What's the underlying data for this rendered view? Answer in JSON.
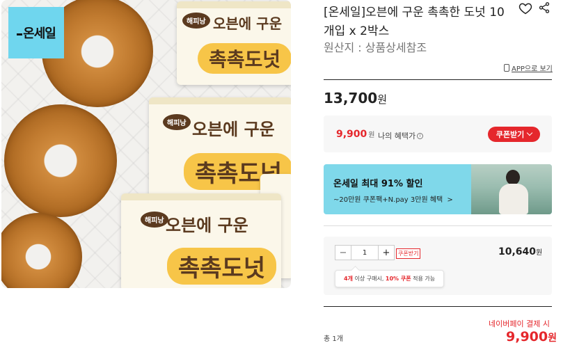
{
  "image": {
    "badge": "온세일",
    "packs": [
      {
        "brand": "해피낭",
        "line1": "오븐에 구운",
        "line2": "촉촉도넛"
      },
      {
        "brand": "해피낭",
        "line1": "오븐에 구운",
        "line2": "촉촉도넛"
      },
      {
        "brand": "해피낭",
        "line1": "오븐에 구운",
        "line2": "촉촉도넛"
      }
    ]
  },
  "product": {
    "title": "[온세일]오븐에 구운 촉촉한 도넛 10개입 x 2박스",
    "origin": "원산지 : 상품상세참조",
    "icons": {
      "wish": "heart-icon",
      "share": "share-icon"
    },
    "app_view": "APP으로 보기",
    "price": "13,700",
    "price_unit": "원"
  },
  "benefit": {
    "price": "9,900",
    "price_unit": "원",
    "label": "나의 혜택가",
    "coupon_button": "쿠폰받기"
  },
  "promo": {
    "title": "온세일 최대 91% 할인",
    "subtitle": "~20만원 쿠폰팩+N.pay 3만원 혜택",
    "arrow": ">"
  },
  "option": {
    "quantity": "1",
    "minus": "−",
    "plus": "+",
    "coupon_tag": "쿠폰받기",
    "price": "10,640",
    "price_unit": "원",
    "tooltip_pre": "4개",
    "tooltip_mid": " 이상 구매시, ",
    "tooltip_discount": "10% 쿠폰",
    "tooltip_post": " 적용 가능"
  },
  "total": {
    "npay_label": "네이버페이 결제 시",
    "count": "총 1개",
    "price": "9,900",
    "price_unit": "원"
  },
  "colors": {
    "accent": "#e5272c",
    "promo_bg": "#7fd8ea",
    "badge_bg": "#6fd6ee"
  }
}
